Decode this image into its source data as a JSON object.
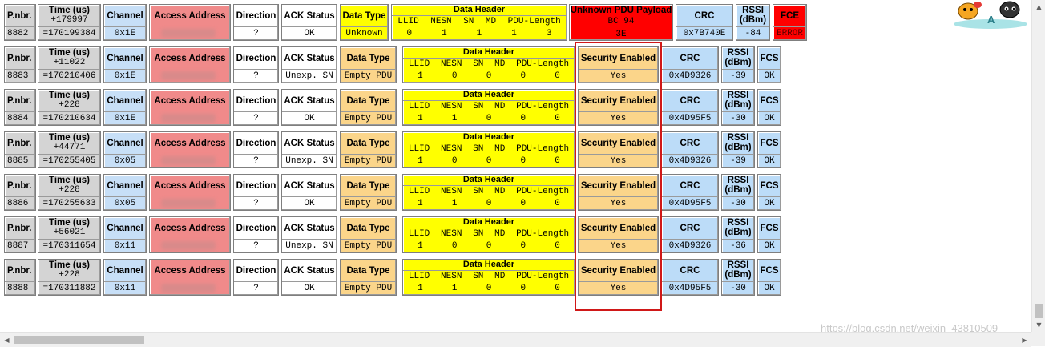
{
  "labels": {
    "pnbr": "P.nbr.",
    "time": "Time (us)",
    "channel": "Channel",
    "access_address": "Access Address",
    "direction": "Direction",
    "ack_status": "ACK Status",
    "data_type": "Data Type",
    "data_header": "Data Header",
    "dh_fields": [
      "LLID",
      "NESN",
      "SN",
      "MD",
      "PDU-Length"
    ],
    "unknown_payload": "Unknown PDU Payload",
    "security": "Security Enabled",
    "crc": "CRC",
    "rssi_1": "RSSI",
    "rssi_2": "(dBm)",
    "fcs": "FCS",
    "fce": "FCE"
  },
  "packets": [
    {
      "pnbr": "8882",
      "delta": "+179997",
      "abs": "=170199384",
      "channel": "0x1E",
      "direction": "?",
      "ack": "OK",
      "data_type": "Unknown",
      "dh": [
        "0",
        "1",
        "1",
        "1",
        "3"
      ],
      "payload_1": "BC 94",
      "payload_2": "3E",
      "crc": "0x7B740E",
      "rssi": "-84",
      "fce": "ERROR"
    },
    {
      "pnbr": "8883",
      "delta": "+11022",
      "abs": "=170210406",
      "channel": "0x1E",
      "direction": "?",
      "ack": "Unexp. SN",
      "data_type": "Empty PDU",
      "dh": [
        "1",
        "0",
        "0",
        "0",
        "0"
      ],
      "security": "Yes",
      "crc": "0x4D9326",
      "rssi": "-39",
      "fcs": "OK"
    },
    {
      "pnbr": "8884",
      "delta": "+228",
      "abs": "=170210634",
      "channel": "0x1E",
      "direction": "?",
      "ack": "OK",
      "data_type": "Empty PDU",
      "dh": [
        "1",
        "1",
        "0",
        "0",
        "0"
      ],
      "security": "Yes",
      "crc": "0x4D95F5",
      "rssi": "-30",
      "fcs": "OK"
    },
    {
      "pnbr": "8885",
      "delta": "+44771",
      "abs": "=170255405",
      "channel": "0x05",
      "direction": "?",
      "ack": "Unexp. SN",
      "data_type": "Empty PDU",
      "dh": [
        "1",
        "0",
        "0",
        "0",
        "0"
      ],
      "security": "Yes",
      "crc": "0x4D9326",
      "rssi": "-39",
      "fcs": "OK"
    },
    {
      "pnbr": "8886",
      "delta": "+228",
      "abs": "=170255633",
      "channel": "0x05",
      "direction": "?",
      "ack": "OK",
      "data_type": "Empty PDU",
      "dh": [
        "1",
        "1",
        "0",
        "0",
        "0"
      ],
      "security": "Yes",
      "crc": "0x4D95F5",
      "rssi": "-30",
      "fcs": "OK"
    },
    {
      "pnbr": "8887",
      "delta": "+56021",
      "abs": "=170311654",
      "channel": "0x11",
      "direction": "?",
      "ack": "Unexp. SN",
      "data_type": "Empty PDU",
      "dh": [
        "1",
        "0",
        "0",
        "0",
        "0"
      ],
      "security": "Yes",
      "crc": "0x4D9326",
      "rssi": "-36",
      "fcs": "OK"
    },
    {
      "pnbr": "8888",
      "delta": "+228",
      "abs": "=170311882",
      "channel": "0x11",
      "direction": "?",
      "ack": "OK",
      "data_type": "Empty PDU",
      "dh": [
        "1",
        "1",
        "0",
        "0",
        "0"
      ],
      "security": "Yes",
      "crc": "0x4D95F5",
      "rssi": "-30",
      "fcs": "OK"
    }
  ],
  "watermark": "https://blog.csdn.net/weixin_43810509",
  "mascot_letter": "A",
  "scroll": {
    "up": "▲",
    "down": "▼",
    "left": "◀",
    "right": "▶"
  },
  "colors": {
    "unknown_payload": "#ff0000",
    "data_header": "#ffff00",
    "access_address": "#f08a8a",
    "fce": "#ff0000",
    "highlight_box": "#d01818"
  }
}
